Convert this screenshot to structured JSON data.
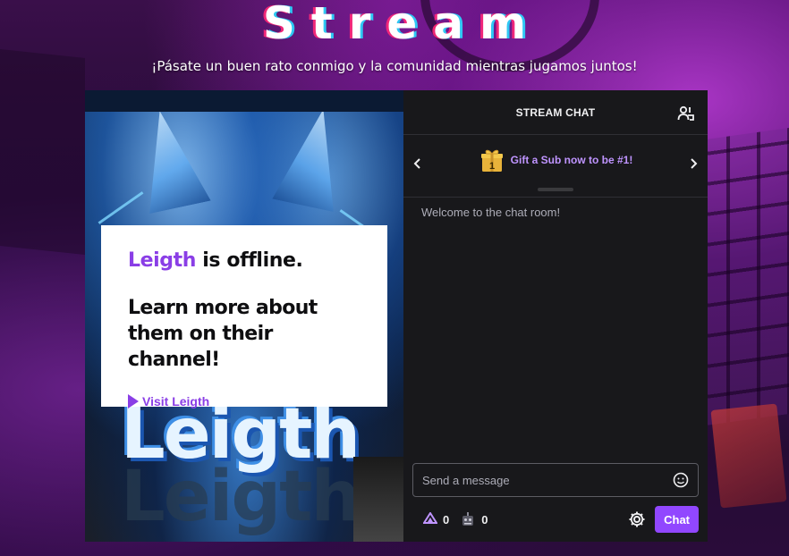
{
  "page": {
    "title": "Stream",
    "subtitle": "¡Pásate un buen rato conmigo y la comunidad mientras jugamos juntos!"
  },
  "player": {
    "channel_name": "Leigth",
    "offline_suffix": " is offline.",
    "learn_more": "Learn more about them on their channel!",
    "visit_link": "Visit Leigth",
    "art_logo": "Leigth"
  },
  "chat": {
    "header_title": "STREAM CHAT",
    "gift_banner_text": "Gift a Sub now to be #1!",
    "gift_badge_number": "1",
    "welcome_message": "Welcome to the chat room!",
    "input_placeholder": "Send a message",
    "channel_points": "0",
    "bits_count": "0",
    "send_button": "Chat"
  },
  "colors": {
    "accent": "#9147ff",
    "channel_name": "#8a3ee6",
    "gift_text": "#bf94ff",
    "chat_bg": "#18181b"
  },
  "icons": [
    "users-icon",
    "chevron-left-icon",
    "chevron-right-icon",
    "gift-icon",
    "emote-icon",
    "channel-points-icon",
    "bits-icon",
    "gear-icon",
    "play-icon"
  ]
}
